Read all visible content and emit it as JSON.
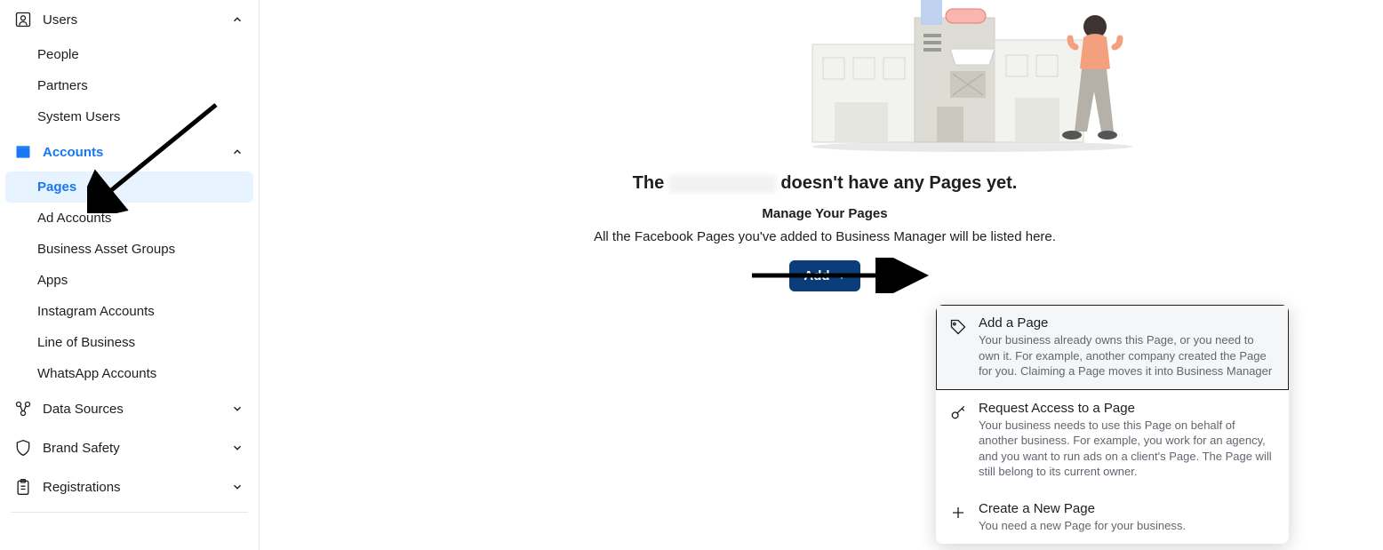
{
  "sidebar": {
    "sections": [
      {
        "id": "users",
        "label": "Users",
        "icon": "user-badge-icon",
        "expanded": true,
        "active": false,
        "items": [
          {
            "label": "People",
            "active": false
          },
          {
            "label": "Partners",
            "active": false
          },
          {
            "label": "System Users",
            "active": false
          }
        ]
      },
      {
        "id": "accounts",
        "label": "Accounts",
        "icon": "box-icon",
        "expanded": true,
        "active": true,
        "items": [
          {
            "label": "Pages",
            "active": true
          },
          {
            "label": "Ad Accounts",
            "active": false
          },
          {
            "label": "Business Asset Groups",
            "active": false
          },
          {
            "label": "Apps",
            "active": false
          },
          {
            "label": "Instagram Accounts",
            "active": false
          },
          {
            "label": "Line of Business",
            "active": false
          },
          {
            "label": "WhatsApp Accounts",
            "active": false
          }
        ]
      },
      {
        "id": "data-sources",
        "label": "Data Sources",
        "icon": "nodes-icon",
        "expanded": false,
        "active": false,
        "items": []
      },
      {
        "id": "brand-safety",
        "label": "Brand Safety",
        "icon": "shield-icon",
        "expanded": false,
        "active": false,
        "items": []
      },
      {
        "id": "registrations",
        "label": "Registrations",
        "icon": "clipboard-icon",
        "expanded": false,
        "active": false,
        "items": []
      }
    ]
  },
  "main": {
    "heading_prefix": "The ",
    "heading_suffix": " doesn't have any Pages yet.",
    "subheading": "Manage Your Pages",
    "description": "All the Facebook Pages you've added to Business Manager will be listed here.",
    "add_button_label": "Add"
  },
  "dropdown": {
    "items": [
      {
        "title": "Add a Page",
        "desc": "Your business already owns this Page, or you need to own it. For example, another company created the Page for you. Claiming a Page moves it into Business Manager",
        "icon": "tag-icon",
        "highlighted": true
      },
      {
        "title": "Request Access to a Page",
        "desc": "Your business needs to use this Page on behalf of another business. For example, you work for an agency, and you want to run ads on a client's Page. The Page will still belong to its current owner.",
        "icon": "key-icon",
        "highlighted": false
      },
      {
        "title": "Create a New Page",
        "desc": "You need a new Page for your business.",
        "icon": "plus-icon",
        "highlighted": false
      }
    ]
  }
}
